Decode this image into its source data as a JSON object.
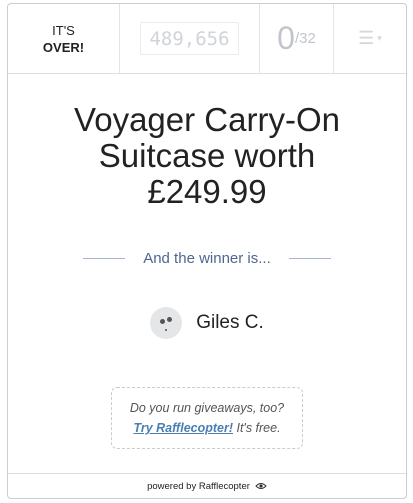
{
  "status": {
    "line1": "IT'S",
    "line2": "OVER!"
  },
  "total_entries": "489,656",
  "user_entries": {
    "count": "0",
    "max": "/32"
  },
  "menu": {
    "icon": "menu-icon"
  },
  "prize": {
    "line1": "Voyager Carry-On",
    "line2": "Suitcase worth",
    "line3": "£249.99"
  },
  "winner_heading": "And the winner is...",
  "winner": {
    "name": "Giles C.",
    "avatar_icon": "default-avatar-icon"
  },
  "promo": {
    "question": "Do you run giveaways, too?",
    "link_label": "Try Rafflecopter!",
    "suffix": " It's free."
  },
  "footer": {
    "text": "powered by Rafflecopter",
    "icon": "eye-logo-icon"
  }
}
